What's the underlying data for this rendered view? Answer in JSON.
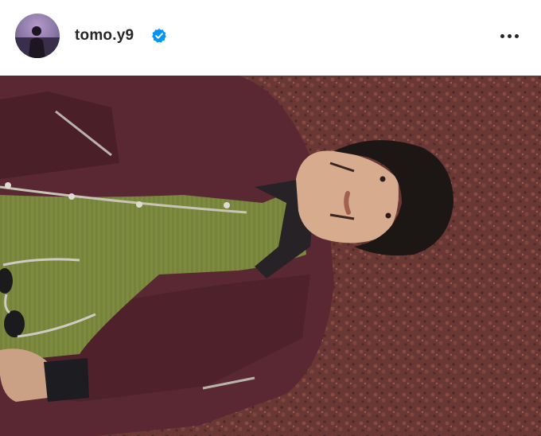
{
  "post": {
    "username": "tomo.y9",
    "verified": true,
    "avatar_icon": "profile-avatar",
    "more_icon": "more-options-icon",
    "photo_description_icon": "post-photo"
  },
  "colors": {
    "text": "#262626",
    "verified_blue": "#0095f6",
    "gravel": "#6b3a35",
    "jacket": "#5b2a33",
    "sweater": "#7d8a3c"
  }
}
